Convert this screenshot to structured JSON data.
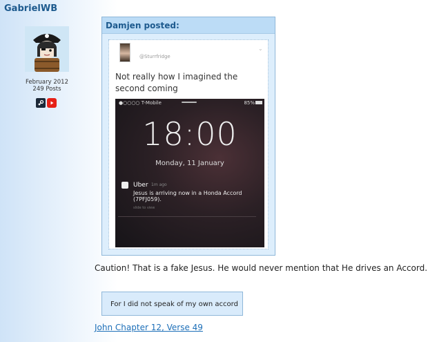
{
  "author": {
    "username": "GabrielWB",
    "joined": "February 2012",
    "posts": "249 Posts",
    "social": [
      "steam-icon",
      "youtube-icon"
    ]
  },
  "quote": {
    "header": "Damjen posted:",
    "tweet": {
      "handle": "@Sturrfridge",
      "text": "Not really how I imagined the second coming",
      "phone": {
        "carrier": "●○○○○ T-Mobile",
        "battery": "85%",
        "time": "18:00",
        "date": "Monday, 11 January",
        "notification": {
          "app": "Uber",
          "ago": "1m ago",
          "message": "Jesus is arriving now in a Honda Accord (7PFJ059).",
          "slide": "slide to view"
        }
      }
    }
  },
  "reply": {
    "text": "Caution! That is a fake Jesus. He would never mention that He drives an Accord.",
    "spoiler": "For I did not speak of my own accord",
    "verse_link": "John Chapter 12, Verse 49"
  }
}
